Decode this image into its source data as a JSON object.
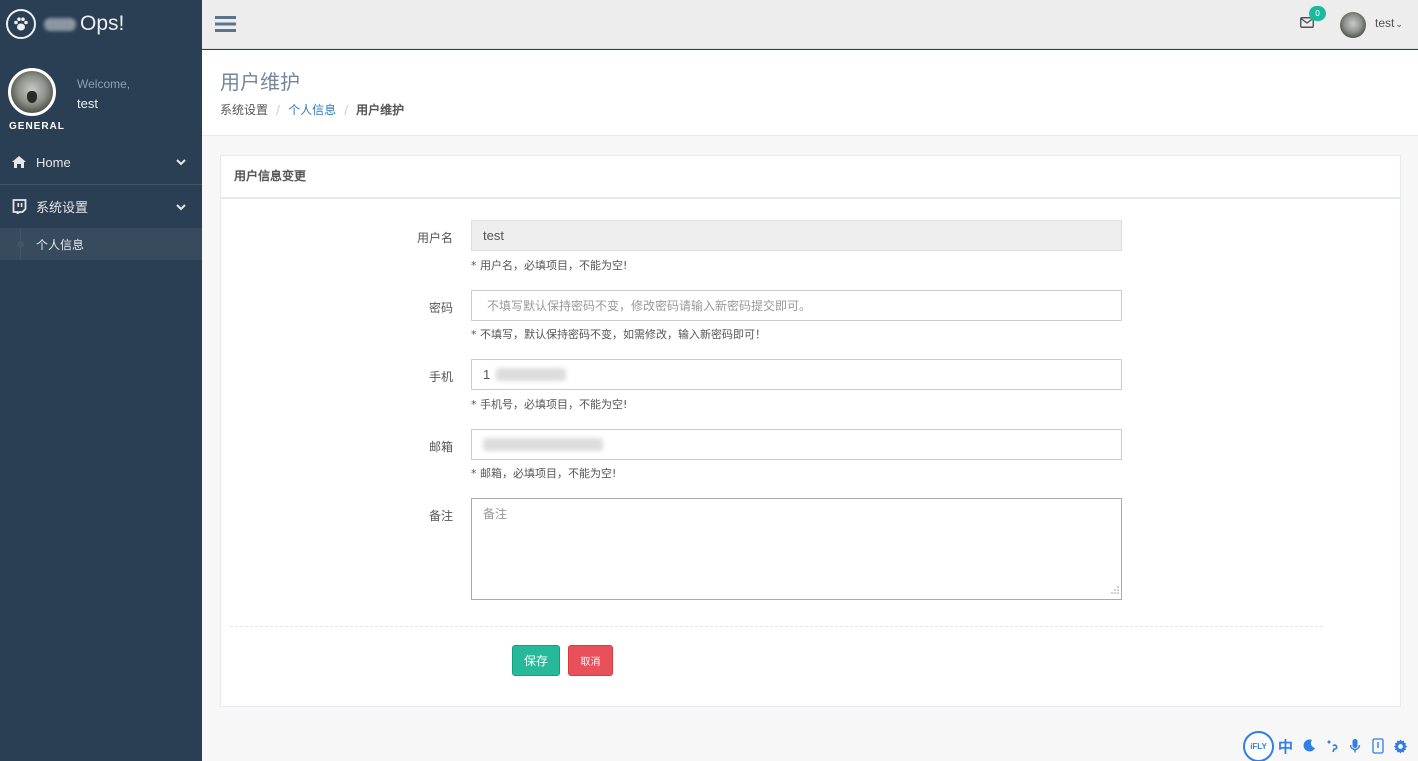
{
  "brand": {
    "title": "Ops!"
  },
  "profile": {
    "welcome": "Welcome,",
    "username": "test",
    "section": "GENERAL"
  },
  "sidebar": {
    "items": [
      {
        "label": "Home"
      },
      {
        "label": "系统设置",
        "children": [
          {
            "label": "个人信息"
          }
        ]
      }
    ]
  },
  "topnav": {
    "badge_count": "0",
    "user": "test"
  },
  "page": {
    "title": "用户维护",
    "breadcrumb": [
      "系统设置",
      "个人信息",
      "用户维护"
    ]
  },
  "panel": {
    "title": "用户信息变更"
  },
  "form": {
    "username": {
      "label": "用户名",
      "value": "test",
      "help": "* 用户名，必填项目，不能为空!"
    },
    "password": {
      "label": "密码",
      "placeholder": "不填写默认保持密码不变，修改密码请输入新密码提交即可。",
      "help": "* 不填写，默认保持密码不变，如需修改，输入新密码即可！"
    },
    "phone": {
      "label": "手机",
      "value": "1",
      "help": "* 手机号，必填项目，不能为空!"
    },
    "email": {
      "label": "邮箱",
      "value": "",
      "help": "* 邮箱，必填项目，不能为空!"
    },
    "note": {
      "label": "备注",
      "placeholder": "备注"
    },
    "save_label": "保存",
    "cancel_label": "取消"
  },
  "ifly": {
    "logo": "iFLY",
    "lang": "中"
  },
  "colors": {
    "sidebar": "#2a3f54",
    "accent": "#1abb9c",
    "save": "#26b99a",
    "cancel": "#e9505c",
    "link": "#337ab7"
  }
}
